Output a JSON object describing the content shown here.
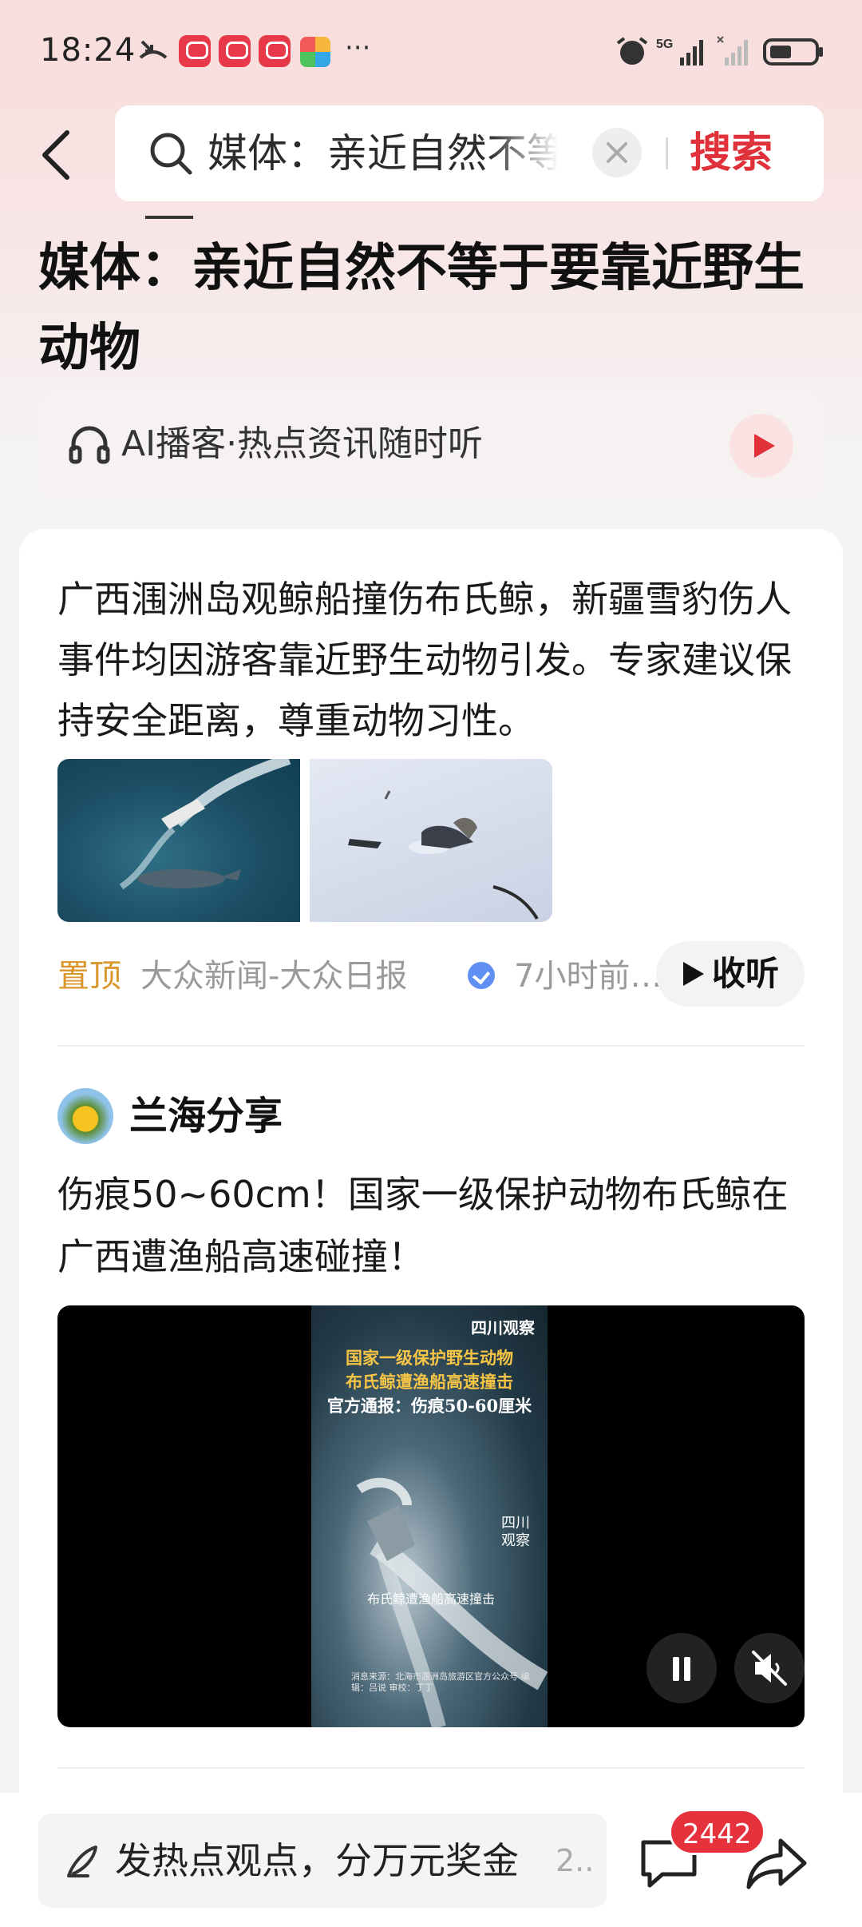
{
  "status_bar": {
    "time": "18:24",
    "more": "···",
    "network": "5G"
  },
  "search": {
    "query": "媒体：亲近自然不等于要靠近野生动物",
    "button": "搜索"
  },
  "article": {
    "title": "媒体：亲近自然不等于要靠近野生动物"
  },
  "podcast": {
    "label": "AI播客·热点资讯随时听"
  },
  "news_card": {
    "summary": "广西涠洲岛观鲸船撞伤布氏鲸，新疆雪豹伤人事件均因游客靠近野生动物引发。专家建议保持安全距离，尊重动物习性。",
    "pin_tag": "置顶",
    "source": "大众新闻-大众日报",
    "time": "7小时前…",
    "listen": "收听"
  },
  "post": {
    "author": "兰海分享",
    "text": "伤痕50~60cm！国家一级保护动物布氏鲸在广西遭渔船高速碰撞！",
    "video": {
      "brand": "四川观察",
      "line1": "国家一级保护野生动物",
      "line2": "布氏鲸遭渔船高速撞击",
      "line3": "官方通报：伤痕50-60厘米",
      "side": "四川观察",
      "caption": "布氏鲸遭渔船高速撞击",
      "credits": "消息来源：北海市涠洲岛旅游区官方公众号 编辑：吕说 审校：丁丁"
    }
  },
  "bottom_bar": {
    "placeholder": "发热点观点，分万元奖金",
    "more": "2..",
    "comment_count": "2442"
  },
  "colors": {
    "accent": "#e0303a",
    "pin": "#d9962a",
    "badge": "#e6323c"
  }
}
